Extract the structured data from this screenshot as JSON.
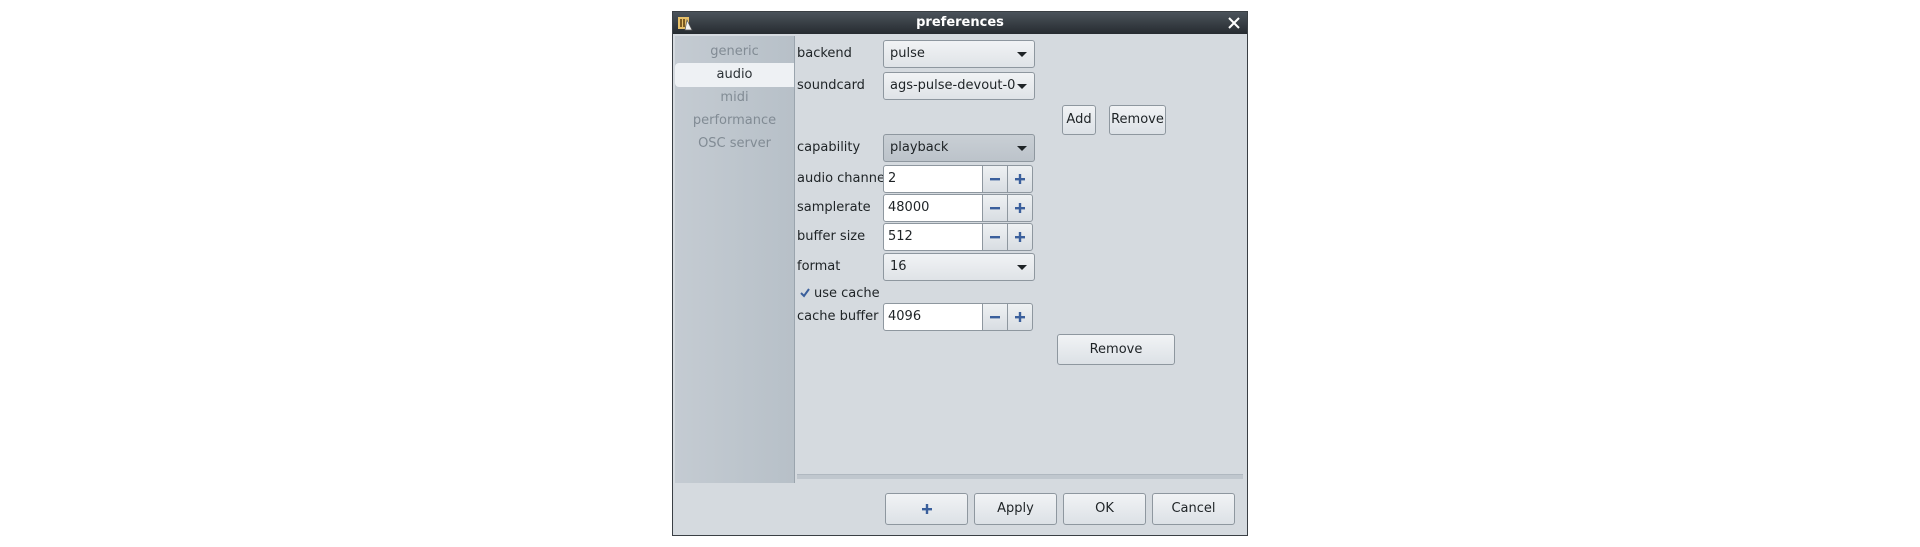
{
  "window": {
    "title": "preferences",
    "app_icon": "app-icon",
    "close_icon": "close-icon"
  },
  "sidebar": {
    "items": [
      {
        "label": "generic",
        "active": false
      },
      {
        "label": "audio",
        "active": true
      },
      {
        "label": "midi",
        "active": false
      },
      {
        "label": "performance",
        "active": false
      },
      {
        "label": "OSC server",
        "active": false
      }
    ]
  },
  "audio": {
    "backend": {
      "label": "backend",
      "value": "pulse"
    },
    "soundcard": {
      "label": "soundcard",
      "value": "ags-pulse-devout-0"
    },
    "add_label": "Add",
    "remove_label": "Remove",
    "capability": {
      "label": "capability",
      "value": "playback"
    },
    "audio_channels": {
      "label": "audio channels",
      "value": "2"
    },
    "samplerate": {
      "label": "samplerate",
      "value": "48000"
    },
    "buffer_size": {
      "label": "buffer size",
      "value": "512"
    },
    "format": {
      "label": "format",
      "value": "16"
    },
    "use_cache": {
      "label": "use cache",
      "checked": true
    },
    "cache_buffer_size": {
      "label": "cache buffer size",
      "value": "4096"
    },
    "remove_soundcard_label": "Remove"
  },
  "footer": {
    "add_icon": "plus-icon",
    "apply_label": "Apply",
    "ok_label": "OK",
    "cancel_label": "Cancel"
  },
  "colors": {
    "window_bg": "#d5dadf",
    "titlebar": "#2f353a",
    "icon_blue": "#3a5f9c"
  }
}
